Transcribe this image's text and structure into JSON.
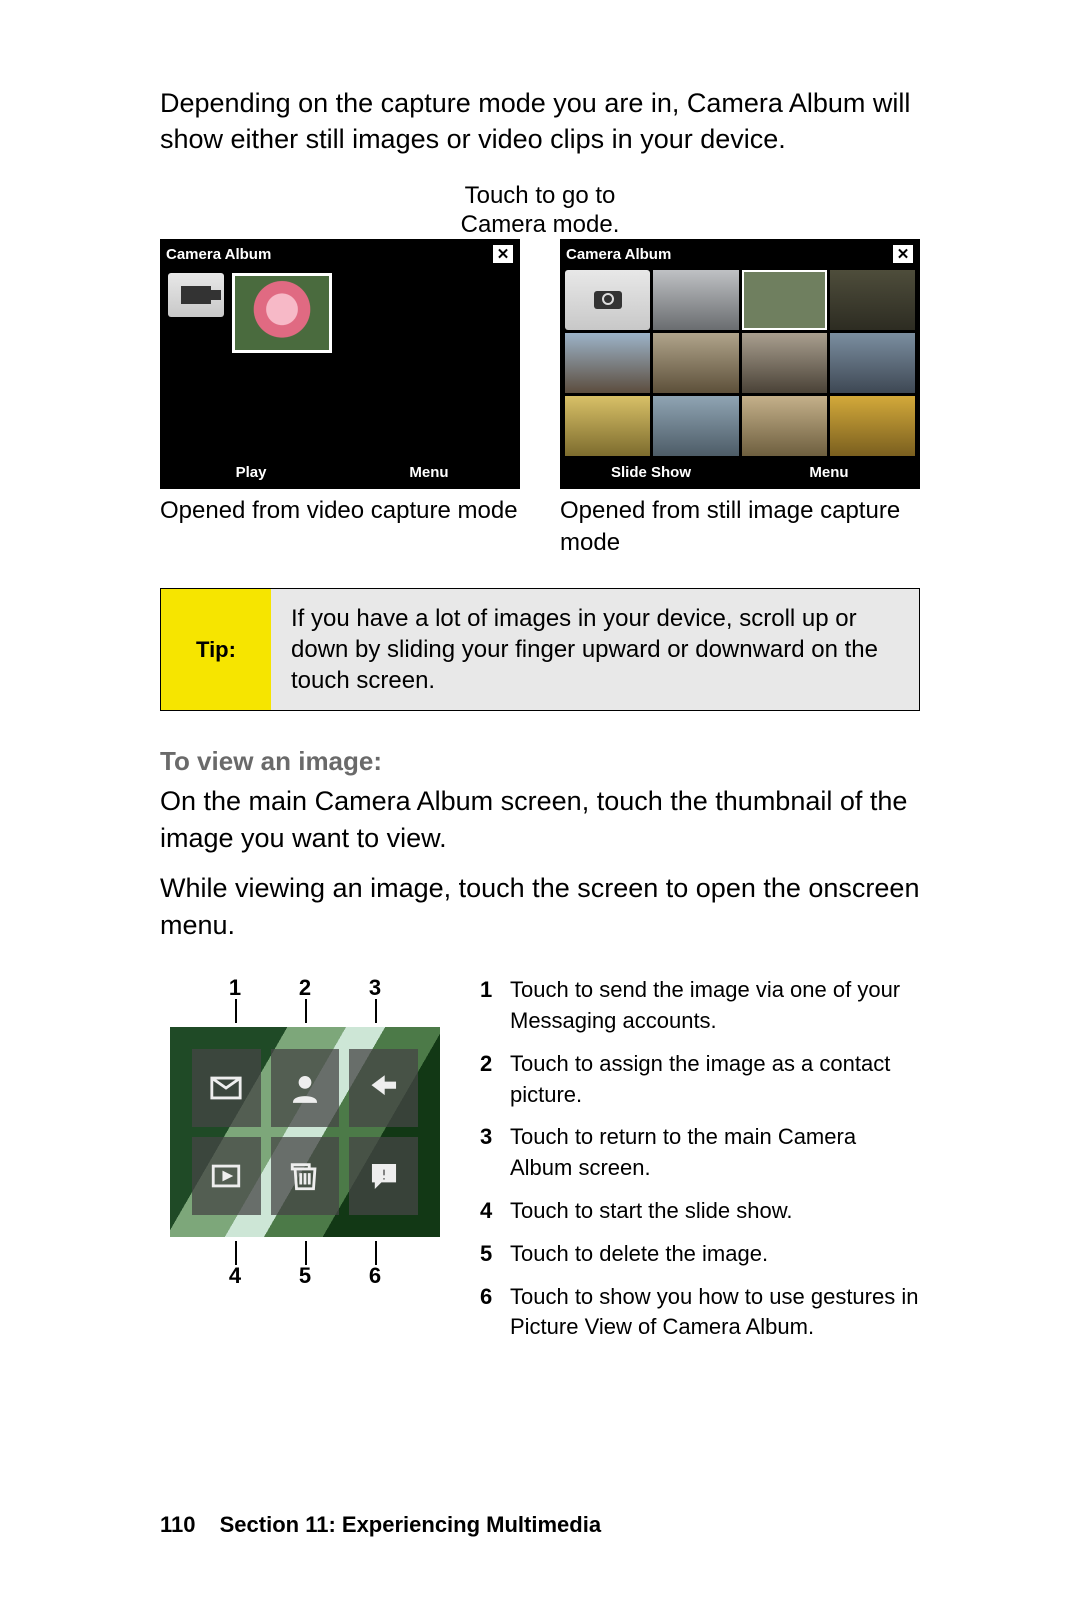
{
  "intro": "Depending on the capture mode you are in, Camera Album will show either still images or video clips in your device.",
  "top_annotation_line1": "Touch to go to",
  "top_annotation_line2": "Camera mode.",
  "left_shot": {
    "title": "Camera Album",
    "btn_left": "Play",
    "btn_right": "Menu",
    "caption": "Opened from video capture mode"
  },
  "right_shot": {
    "title": "Camera Album",
    "btn_left": "Slide Show",
    "btn_right": "Menu",
    "caption": "Opened from still image capture mode"
  },
  "tip_label": "Tip:",
  "tip_text": "If you have a lot of images in your device, scroll up or down by sliding your finger upward or downward on the touch screen.",
  "heading_view": "To view an image:",
  "para1": "On the main Camera Album screen, touch the thumbnail of the image you want to view.",
  "para2": "While viewing an image, touch the screen to open the onscreen menu.",
  "labels_top": [
    "1",
    "2",
    "3"
  ],
  "labels_bot": [
    "4",
    "5",
    "6"
  ],
  "list": [
    {
      "n": "1",
      "t": "Touch to send the image via one of your Messaging accounts."
    },
    {
      "n": "2",
      "t": "Touch to assign the image as a contact picture."
    },
    {
      "n": "3",
      "t": "Touch to return to the main Camera Album screen."
    },
    {
      "n": "4",
      "t": "Touch to start the slide show."
    },
    {
      "n": "5",
      "t": "Touch to delete the image."
    },
    {
      "n": "6",
      "t": "Touch to show you how to use gestures in Picture View of Camera Album."
    }
  ],
  "footer": {
    "page": "110",
    "section": "Section 11: Experiencing Multimedia"
  }
}
